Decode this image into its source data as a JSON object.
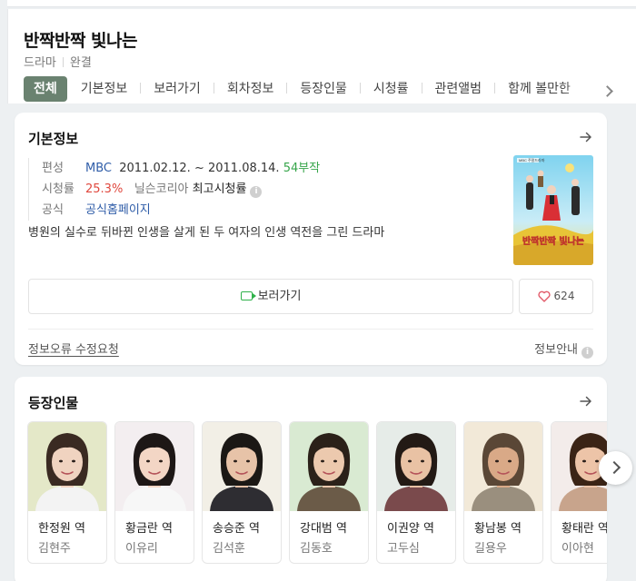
{
  "header": {
    "title": "반짝반짝 빛나는",
    "meta": [
      "드라마",
      "완결"
    ]
  },
  "tabs": [
    "전체",
    "기본정보",
    "보러가기",
    "회차정보",
    "등장인물",
    "시청률",
    "관련앨범",
    "함께 볼만한"
  ],
  "basic_info": {
    "title": "기본정보",
    "broadcast_label": "편성",
    "channel": "MBC",
    "period": "2011.02.12. ~ 2011.08.14.",
    "episodes": "54부작",
    "rating_label": "시청률",
    "rating": "25.3%",
    "rating_source": "닐슨코리아",
    "rating_note": "최고시청률",
    "official_label": "공식",
    "official_link": "공식홈페이지",
    "description": "병원의 실수로 뒤바뀐 인생을 살게 된 두 여자의 인생 역전을 그린 드라마",
    "poster_alt": "반짝반짝 빛나는 포스터",
    "poster_text": "반짝반짝 빛나는",
    "poster_badge": "MBC 주말드라마",
    "watch_label": "보러가기",
    "like_count": "624",
    "report_link": "정보오류 수정요청",
    "guide_label": "정보안내"
  },
  "cast": {
    "title": "등장인물",
    "people": [
      {
        "role": "한정원 역",
        "actor": "김현주",
        "skin": "#f0d3c0",
        "hair": "#3a2a22",
        "bg": "#e4e8c8",
        "cloth": "#f3f3f3"
      },
      {
        "role": "황금란 역",
        "actor": "이유리",
        "skin": "#f3d6c5",
        "hair": "#1d1716",
        "bg": "#f3eef0",
        "cloth": "#f7f7f7"
      },
      {
        "role": "송승준 역",
        "actor": "김석훈",
        "skin": "#e7c3a8",
        "hair": "#1b1815",
        "bg": "#f2efe6",
        "cloth": "#2e2d32"
      },
      {
        "role": "강대범 역",
        "actor": "김동호",
        "skin": "#ecc9ae",
        "hair": "#2b2119",
        "bg": "#d9ead2",
        "cloth": "#6b5b48"
      },
      {
        "role": "이권양 역",
        "actor": "고두심",
        "skin": "#e9c2a4",
        "hair": "#231a15",
        "bg": "#e6ece8",
        "cloth": "#7a4a4c"
      },
      {
        "role": "황남봉 역",
        "actor": "길용우",
        "skin": "#d9a987",
        "hair": "#5a4736",
        "bg": "#f2e9d8",
        "cloth": "#9a8f7e"
      },
      {
        "role": "황태란 역",
        "actor": "이아현",
        "skin": "#edc4a8",
        "hair": "#3b2416",
        "bg": "#f3ecea",
        "cloth": "#c8a48c"
      }
    ]
  }
}
